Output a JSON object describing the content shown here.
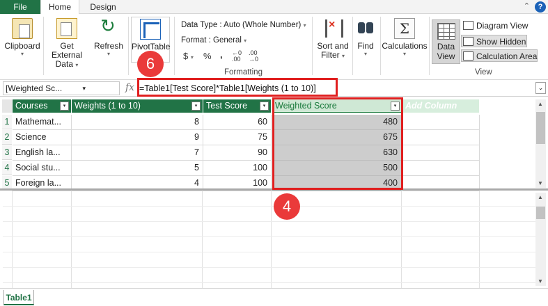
{
  "tabs": {
    "file": "File",
    "home": "Home",
    "design": "Design"
  },
  "window": {
    "min_glyph": "⌃",
    "help_glyph": "?"
  },
  "ribbon": {
    "clipboard": {
      "label": "Clipboard",
      "caret": "▾",
      "icon": "clipboard-icon"
    },
    "get_external": {
      "line1": "Get External",
      "line2": "Data",
      "caret": "▾",
      "icon": "database-icon"
    },
    "refresh": {
      "label": "Refresh",
      "caret": "▾",
      "icon": "refresh-icon"
    },
    "pivot": {
      "label": "PivotTable",
      "icon": "pivot-icon"
    },
    "format": {
      "data_type": "Data Type : Auto (Whole Number)",
      "format": "Format : General",
      "caret": "▾",
      "currency": "$",
      "percent": "%",
      "thousands": ",",
      "inc_dec_top": "←0",
      "inc_dec_bot": ".00",
      "dec_dec_top": ".00",
      "dec_dec_bot": "→0",
      "group_label": "Formatting"
    },
    "sort": {
      "line1": "Sort and",
      "line2": "Filter",
      "caret": "▾",
      "icon": "sort-filter-icon"
    },
    "find": {
      "label": "Find",
      "caret": "▾",
      "icon": "binoculars-icon"
    },
    "calculations": {
      "label": "Calculations",
      "caret": "▾",
      "glyph": "Σ"
    },
    "view": {
      "data_view_1": "Data",
      "data_view_2": "View",
      "diagram_view": "Diagram View",
      "show_hidden": "Show Hidden",
      "calc_area": "Calculation Area",
      "group_label": "View"
    }
  },
  "formula_bar": {
    "name_box": "[Weighted Sc...",
    "name_caret": "▾",
    "fx": "fx",
    "formula": "=Table1[Test Score]*Table1[Weights (1 to 10)]",
    "expand": "⌄"
  },
  "table": {
    "headers": {
      "courses": "Courses",
      "weights": "Weights (1 to 10)",
      "test": "Test Score",
      "ws": "Weighted Score",
      "add": "Add Column",
      "dd": "▾"
    },
    "rows": [
      {
        "n": "1",
        "course": "Mathemat...",
        "weight": "8",
        "score": "60",
        "ws": "480"
      },
      {
        "n": "2",
        "course": "Science",
        "weight": "9",
        "score": "75",
        "ws": "675"
      },
      {
        "n": "3",
        "course": "English la...",
        "weight": "7",
        "score": "90",
        "ws": "630"
      },
      {
        "n": "4",
        "course": "Social stu...",
        "weight": "5",
        "score": "100",
        "ws": "500"
      },
      {
        "n": "5",
        "course": "Foreign la...",
        "weight": "4",
        "score": "100",
        "ws": "400"
      }
    ]
  },
  "scroll": {
    "up": "▲",
    "down": "▼"
  },
  "sheet_tab": "Table1",
  "annotations": {
    "badge_formula": "6",
    "badge_column": "4"
  },
  "colors": {
    "accent": "#217346",
    "callout": "#e01f1f"
  }
}
